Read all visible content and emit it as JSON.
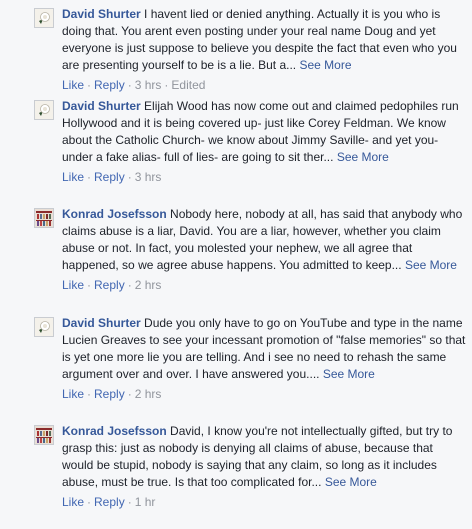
{
  "comments": [
    {
      "author": "David Shurter",
      "text": "I havent lied or denied anything. Actually it is you who is doing that. You arent even posting under your real name Doug and yet everyone is just suppose to believe you despite the fact that even who you are presenting yourself to be is a lie. But a...",
      "see_more": "See More",
      "like": "Like",
      "reply": "Reply",
      "dot": "·",
      "time": "3 hrs",
      "edited": "Edited",
      "avatar_icon": "rose-avatar-icon"
    },
    {
      "author": "David Shurter",
      "text": "Elijah Wood has now come out and claimed pedophiles run Hollywood and it is being covered up- just like Corey Feldman. We know about the Catholic Church- we know about Jimmy Saville- and yet you- under a fake alias- full of lies- are going to sit ther...",
      "see_more": "See More",
      "like": "Like",
      "reply": "Reply",
      "dot": "·",
      "time": "3 hrs",
      "avatar_icon": "rose-avatar-icon"
    },
    {
      "author": "Konrad Josefsson",
      "text": "Nobody here, nobody at all, has said that anybody who claims abuse is a liar, David. You are a liar, however, whether you claim abuse or not. In fact, you molested your nephew, we all agree that happened, so we agree abuse happens. You admitted to keep...",
      "see_more": "See More",
      "like": "Like",
      "reply": "Reply",
      "dot": "·",
      "time": "2 hrs",
      "avatar_icon": "bookshelf-avatar-icon"
    },
    {
      "author": "David Shurter",
      "text": "Dude you only have to go on YouTube and type in the name Lucien Greaves to see your incessant promotion of \"false memories\" so that is yet one more lie you are telling. And i see no need to rehash the same argument over and over. I have answered you....",
      "see_more": "See More",
      "like": "Like",
      "reply": "Reply",
      "dot": "·",
      "time": "2 hrs",
      "avatar_icon": "rose-avatar-icon"
    },
    {
      "author": "Konrad Josefsson",
      "text": "David, I know you're not intellectually gifted, but try to grasp this: just as nobody is denying all claims of abuse, because that would be stupid, nobody is saying that any claim, so long as it includes abuse, must be true. Is that too complicated for...",
      "see_more": "See More",
      "like": "Like",
      "reply": "Reply",
      "dot": "·",
      "time": "1 hr",
      "avatar_icon": "bookshelf-avatar-icon"
    }
  ],
  "colors": {
    "link": "#365899",
    "meta": "#90949c",
    "text": "#1d2129",
    "background": "#f6f7f9"
  }
}
